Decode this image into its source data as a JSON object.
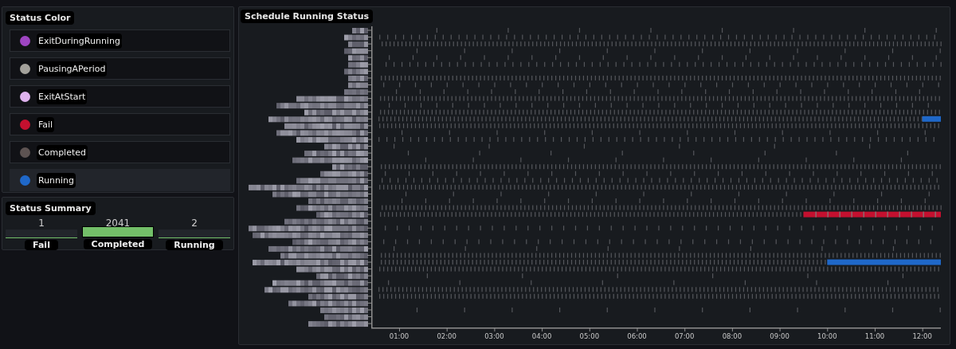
{
  "status_color": {
    "title": "Status Color",
    "items": [
      {
        "label": "ExitDuringRunning",
        "color": "#9e45c2",
        "selected": false
      },
      {
        "label": "PausingAPeriod",
        "color": "#a4a29c",
        "selected": false
      },
      {
        "label": "ExitAtStart",
        "color": "#dfb3ee",
        "selected": false
      },
      {
        "label": "Fail",
        "color": "#c4102f",
        "selected": false
      },
      {
        "label": "Completed",
        "color": "#5d5352",
        "selected": false
      },
      {
        "label": "Running",
        "color": "#1f68c9",
        "selected": true
      }
    ]
  },
  "status_summary": {
    "title": "Status Summary",
    "items": [
      {
        "value": "1",
        "highlighted": false,
        "label": "Fail"
      },
      {
        "value": "2041",
        "highlighted": true,
        "label": "Completed"
      },
      {
        "value": "2",
        "highlighted": false,
        "label": "Running"
      }
    ]
  },
  "schedule": {
    "title": "Schedule Running Status",
    "time_ticks": [
      "01:00",
      "02:00",
      "03:00",
      "04:00",
      "05:00",
      "06:00",
      "07:00",
      "08:00",
      "09:00",
      "10:00",
      "11:00",
      "12:00"
    ]
  }
}
